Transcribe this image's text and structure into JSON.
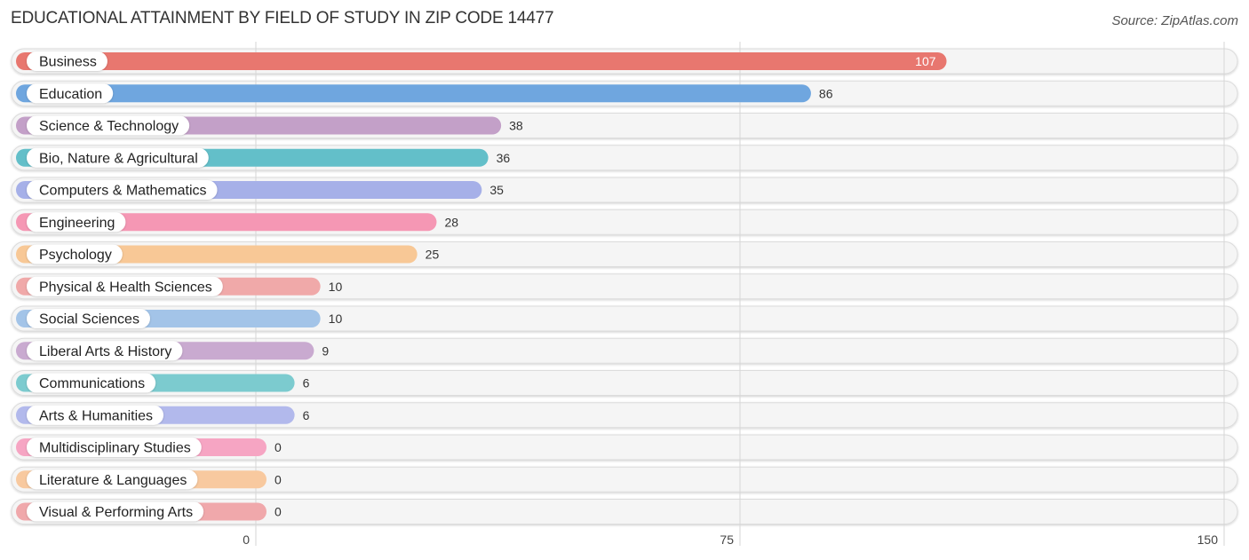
{
  "chart_data": {
    "type": "bar",
    "orientation": "horizontal",
    "title": "EDUCATIONAL ATTAINMENT BY FIELD OF STUDY IN ZIP CODE 14477",
    "source": "Source: ZipAtlas.com",
    "xlabel": "",
    "ylabel": "",
    "xlim": [
      0,
      150
    ],
    "xticks": [
      0,
      75,
      150
    ],
    "xtick_labels": [
      "0",
      "75",
      "150"
    ],
    "grid": true,
    "legend": "none",
    "categories": [
      "Business",
      "Education",
      "Science & Technology",
      "Bio, Nature & Agricultural",
      "Computers & Mathematics",
      "Engineering",
      "Psychology",
      "Physical & Health Sciences",
      "Social Sciences",
      "Liberal Arts & History",
      "Communications",
      "Arts & Humanities",
      "Multidisciplinary Studies",
      "Literature & Languages",
      "Visual & Performing Arts"
    ],
    "values": [
      107,
      86,
      38,
      36,
      35,
      28,
      25,
      10,
      10,
      9,
      6,
      6,
      0,
      0,
      0
    ],
    "value_labels": [
      "107",
      "86",
      "38",
      "36",
      "35",
      "28",
      "25",
      "10",
      "10",
      "9",
      "6",
      "6",
      "0",
      "0",
      "0"
    ],
    "colors": [
      "#e8776f",
      "#6fa6df",
      "#c3a0c8",
      "#63bfc9",
      "#a6b0e8",
      "#f597b4",
      "#f8c896",
      "#f0a9a9",
      "#a3c4e8",
      "#c9aad0",
      "#7ccbcf",
      "#b2b9ec",
      "#f6a5c3",
      "#f8c99f",
      "#f0a8ab"
    ]
  }
}
